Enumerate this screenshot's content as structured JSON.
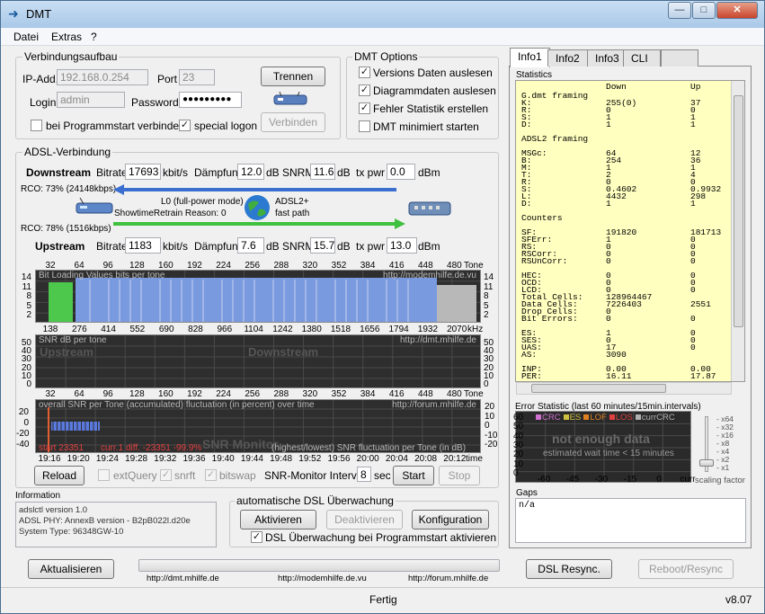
{
  "window": {
    "title": "DMT",
    "min": "—",
    "max": "□",
    "close": "✕"
  },
  "menu": [
    "Datei",
    "Extras",
    "?"
  ],
  "conn": {
    "title": "Verbindungsaufbau",
    "ip_label": "IP-Add.",
    "ip": "192.168.0.254",
    "port_label": "Port",
    "port": "23",
    "login_label": "Login",
    "login": "admin",
    "pw_label": "Password",
    "pw": "●●●●●●●●●",
    "trennen": "Trennen",
    "verbinden": "Verbinden",
    "autoconnect": "bei Programmstart verbinden",
    "special": "special logon"
  },
  "opts": {
    "title": "DMT Options",
    "items": [
      "Versions Daten auslesen",
      "Diagrammdaten auslesen",
      "Fehler Statistik erstellen",
      "DMT minimiert starten"
    ],
    "checked": [
      true,
      true,
      true,
      false
    ]
  },
  "adsl": {
    "title": "ADSL-Verbindung",
    "down": {
      "label": "Downstream",
      "bitrate_label": "Bitrate",
      "bitrate": "17693",
      "unit": "kbit/s",
      "daempf_label": "Dämpfung",
      "daempf": "12.0",
      "db": "dB",
      "snrm_label": "SNRM",
      "snrm": "11.6",
      "txpwr_label": "tx pwr",
      "txpwr": "0.0",
      "dbm": "dBm",
      "rco": "RCO: 73% (24148kbps)"
    },
    "up": {
      "label": "Upstream",
      "bitrate_label": "Bitrate",
      "bitrate": "1183",
      "unit": "kbit/s",
      "daempf_label": "Dämpfung",
      "daempf": "7.6",
      "db": "dB",
      "snrm_label": "SNRM",
      "snrm": "15.7",
      "txpwr_label": "tx pwr",
      "txpwr": "13.0",
      "dbm": "dBm",
      "rco": "RCO: 78% (1516kbps)"
    },
    "mode": "L0 (full-power mode)",
    "retrain": "ShowtimeRetrain Reason: 0",
    "standard": "ADSL2+",
    "path": "fast path"
  },
  "charts": {
    "top_ticks": [
      "32",
      "64",
      "96",
      "128",
      "160",
      "192",
      "224",
      "256",
      "288",
      "320",
      "352",
      "384",
      "416",
      "448",
      "480"
    ],
    "tone_label": "Tone",
    "khz_ticks": [
      "138",
      "276",
      "414",
      "552",
      "690",
      "828",
      "966",
      "1104",
      "1242",
      "1380",
      "1518",
      "1656",
      "1794",
      "1932",
      "2070"
    ],
    "khz_label": "kHz",
    "time_ticks": [
      "19:16",
      "19:20",
      "19:24",
      "19:28",
      "19:32",
      "19:36",
      "19:40",
      "19:44",
      "19:48",
      "19:52",
      "19:56",
      "20:00",
      "20:04",
      "20:08",
      "20:12"
    ],
    "time_label": "time",
    "bitload": {
      "caption": "Bit Loading Values   bits per tone",
      "url": "http://modemhilfe.de.vu",
      "y": [
        "14",
        "11",
        "8",
        "5",
        "2"
      ]
    },
    "snr": {
      "caption": "SNR  dB per tone",
      "url": "http://dmt.mhilfe.de",
      "up": "Upstream",
      "down": "Downstream",
      "y": [
        "50",
        "40",
        "30",
        "20",
        "10",
        "0"
      ]
    },
    "mon": {
      "caption": "overall SNR per Tone (accumulated) fluctuation (in percent) over time",
      "url": "http://forum.mhilfe.de",
      "title": "SNR Monitor",
      "sub": "(highest/lowest) SNR fluctuation per Tone (in dB)",
      "start": "start 23351",
      "curr": "curr.1",
      "diff": "diff.  -23351  -99.9%",
      "yl": [
        "20",
        "0",
        "-20",
        "-40"
      ],
      "yr": [
        "20",
        "10",
        "0",
        "-10",
        "-20"
      ]
    }
  },
  "controls": {
    "reload": "Reload",
    "extquery": "extQuery",
    "snrft": "snrft",
    "bitswap": "bitswap",
    "interval_label": "SNR-Monitor Interval:",
    "interval": "8",
    "sec": "sec",
    "start": "Start",
    "stop": "Stop"
  },
  "info": {
    "title": "Information",
    "lines": [
      "adslctl version 1.0",
      "ADSL PHY: AnnexB version - B2pB022l.d20e",
      "System Type: 96348GW-10"
    ]
  },
  "auto": {
    "title": "automatische DSL Überwachung",
    "aktivieren": "Aktivieren",
    "deaktivieren": "Deaktivieren",
    "konfig": "Konfiguration",
    "startup": "DSL Überwachung bei Programmstart aktivieren"
  },
  "bottom": {
    "aktualisieren": "Aktualisieren",
    "resync": "DSL Resync.",
    "reboot": "Reboot/Resync",
    "links": [
      "http://dmt.mhilfe.de",
      "http://modemhilfe.de.vu",
      "http://forum.mhilfe.de"
    ],
    "status": "Fertig",
    "version": "v8.07"
  },
  "tabs": [
    "Info1",
    "Info2",
    "Info3",
    "CLI"
  ],
  "statistics": {
    "label": "Statistics",
    "head": [
      "Down",
      "Up"
    ],
    "rows": [
      [
        "G.dmt framing",
        "",
        ""
      ],
      [
        "K:",
        "255(0)",
        "37"
      ],
      [
        "R:",
        "0",
        "0"
      ],
      [
        "S:",
        "1",
        "1"
      ],
      [
        "D:",
        "1",
        "1"
      ],
      [
        "",
        "",
        ""
      ],
      [
        "ADSL2 framing",
        "",
        ""
      ],
      [
        "",
        "",
        ""
      ],
      [
        "MSGc:",
        "64",
        "12"
      ],
      [
        "B:",
        "254",
        "36"
      ],
      [
        "M:",
        "1",
        "1"
      ],
      [
        "T:",
        "2",
        "4"
      ],
      [
        "R:",
        "0",
        "0"
      ],
      [
        "S:",
        "0.4602",
        "0.9932"
      ],
      [
        "L:",
        "4432",
        "298"
      ],
      [
        "D:",
        "1",
        "1"
      ],
      [
        "",
        "",
        ""
      ],
      [
        "Counters",
        "",
        ""
      ],
      [
        "",
        "",
        ""
      ],
      [
        "SF:",
        "191820",
        "181713"
      ],
      [
        "SFErr:",
        "1",
        "0"
      ],
      [
        "RS:",
        "0",
        "0"
      ],
      [
        "RSCorr:",
        "0",
        "0"
      ],
      [
        "RSUnCorr:",
        "0",
        "0"
      ],
      [
        "",
        "",
        ""
      ],
      [
        "HEC:",
        "0",
        "0"
      ],
      [
        "OCD:",
        "0",
        "0"
      ],
      [
        "LCD:",
        "0",
        "0"
      ],
      [
        "Total Cells:",
        "128964467",
        ""
      ],
      [
        "Data Cells:",
        "7226403",
        "2551"
      ],
      [
        "Drop Cells:",
        "0",
        ""
      ],
      [
        "Bit Errors:",
        "0",
        "0"
      ],
      [
        "",
        "",
        ""
      ],
      [
        "ES:",
        "1",
        "0"
      ],
      [
        "SES:",
        "0",
        "0"
      ],
      [
        "UAS:",
        "17",
        "0"
      ],
      [
        "AS:",
        "3090",
        ""
      ],
      [
        "",
        "",
        ""
      ],
      [
        "INP:",
        "0.00",
        "0.00"
      ],
      [
        "PER:",
        "16.11",
        "17.87"
      ]
    ]
  },
  "errstat": {
    "label": "Error Statistic (last 60 minutes/15min.intervals)",
    "legend": [
      "CRC",
      "ES",
      "LOF",
      "LOS",
      "currCRC"
    ],
    "legend_colors": [
      "#d070d0",
      "#d0c040",
      "#e08020",
      "#e04040",
      "#b0b0b0"
    ],
    "msg": "not enough data",
    "sub": "estimated wait time < 15 minutes",
    "y": [
      "60",
      "50",
      "40",
      "30",
      "20",
      "10",
      "0"
    ],
    "x": [
      "-60",
      "-45",
      "-30",
      "-15",
      "0",
      "curr"
    ]
  },
  "scale": {
    "label": "scaling factor",
    "marks": [
      "x64",
      "x32",
      "x16",
      "x8",
      "x4",
      "x2",
      "x1"
    ]
  },
  "gaps": {
    "label": "Gaps",
    "value": "n/a"
  }
}
